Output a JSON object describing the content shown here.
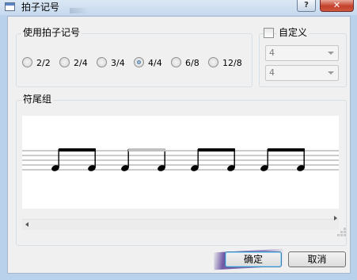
{
  "window": {
    "title": "拍子记号",
    "help_label": "?",
    "close_label": "✕"
  },
  "time_signature_group": {
    "title": "使用拍子记号",
    "options": [
      "2/2",
      "2/4",
      "3/4",
      "4/4",
      "6/8",
      "12/8"
    ],
    "selected": "4/4"
  },
  "custom": {
    "label": "自定义",
    "checked": false,
    "numerator_value": "4",
    "denominator_value": "4"
  },
  "beam_group": {
    "title": "符尾组",
    "beat_groups": [
      {
        "notes": 2,
        "beam_grey": false
      },
      {
        "notes": 2,
        "beam_grey": true
      },
      {
        "notes": 2,
        "beam_grey": false
      },
      {
        "notes": 2,
        "beam_grey": false
      }
    ]
  },
  "buttons": {
    "ok_label": "确定",
    "cancel_label": "取消"
  },
  "colors": {
    "title_bar": "#c6d9ee",
    "close_button": "#c4402c",
    "default_button_border": "#3c7fb1",
    "grey_beam": "#c0c0c0"
  }
}
